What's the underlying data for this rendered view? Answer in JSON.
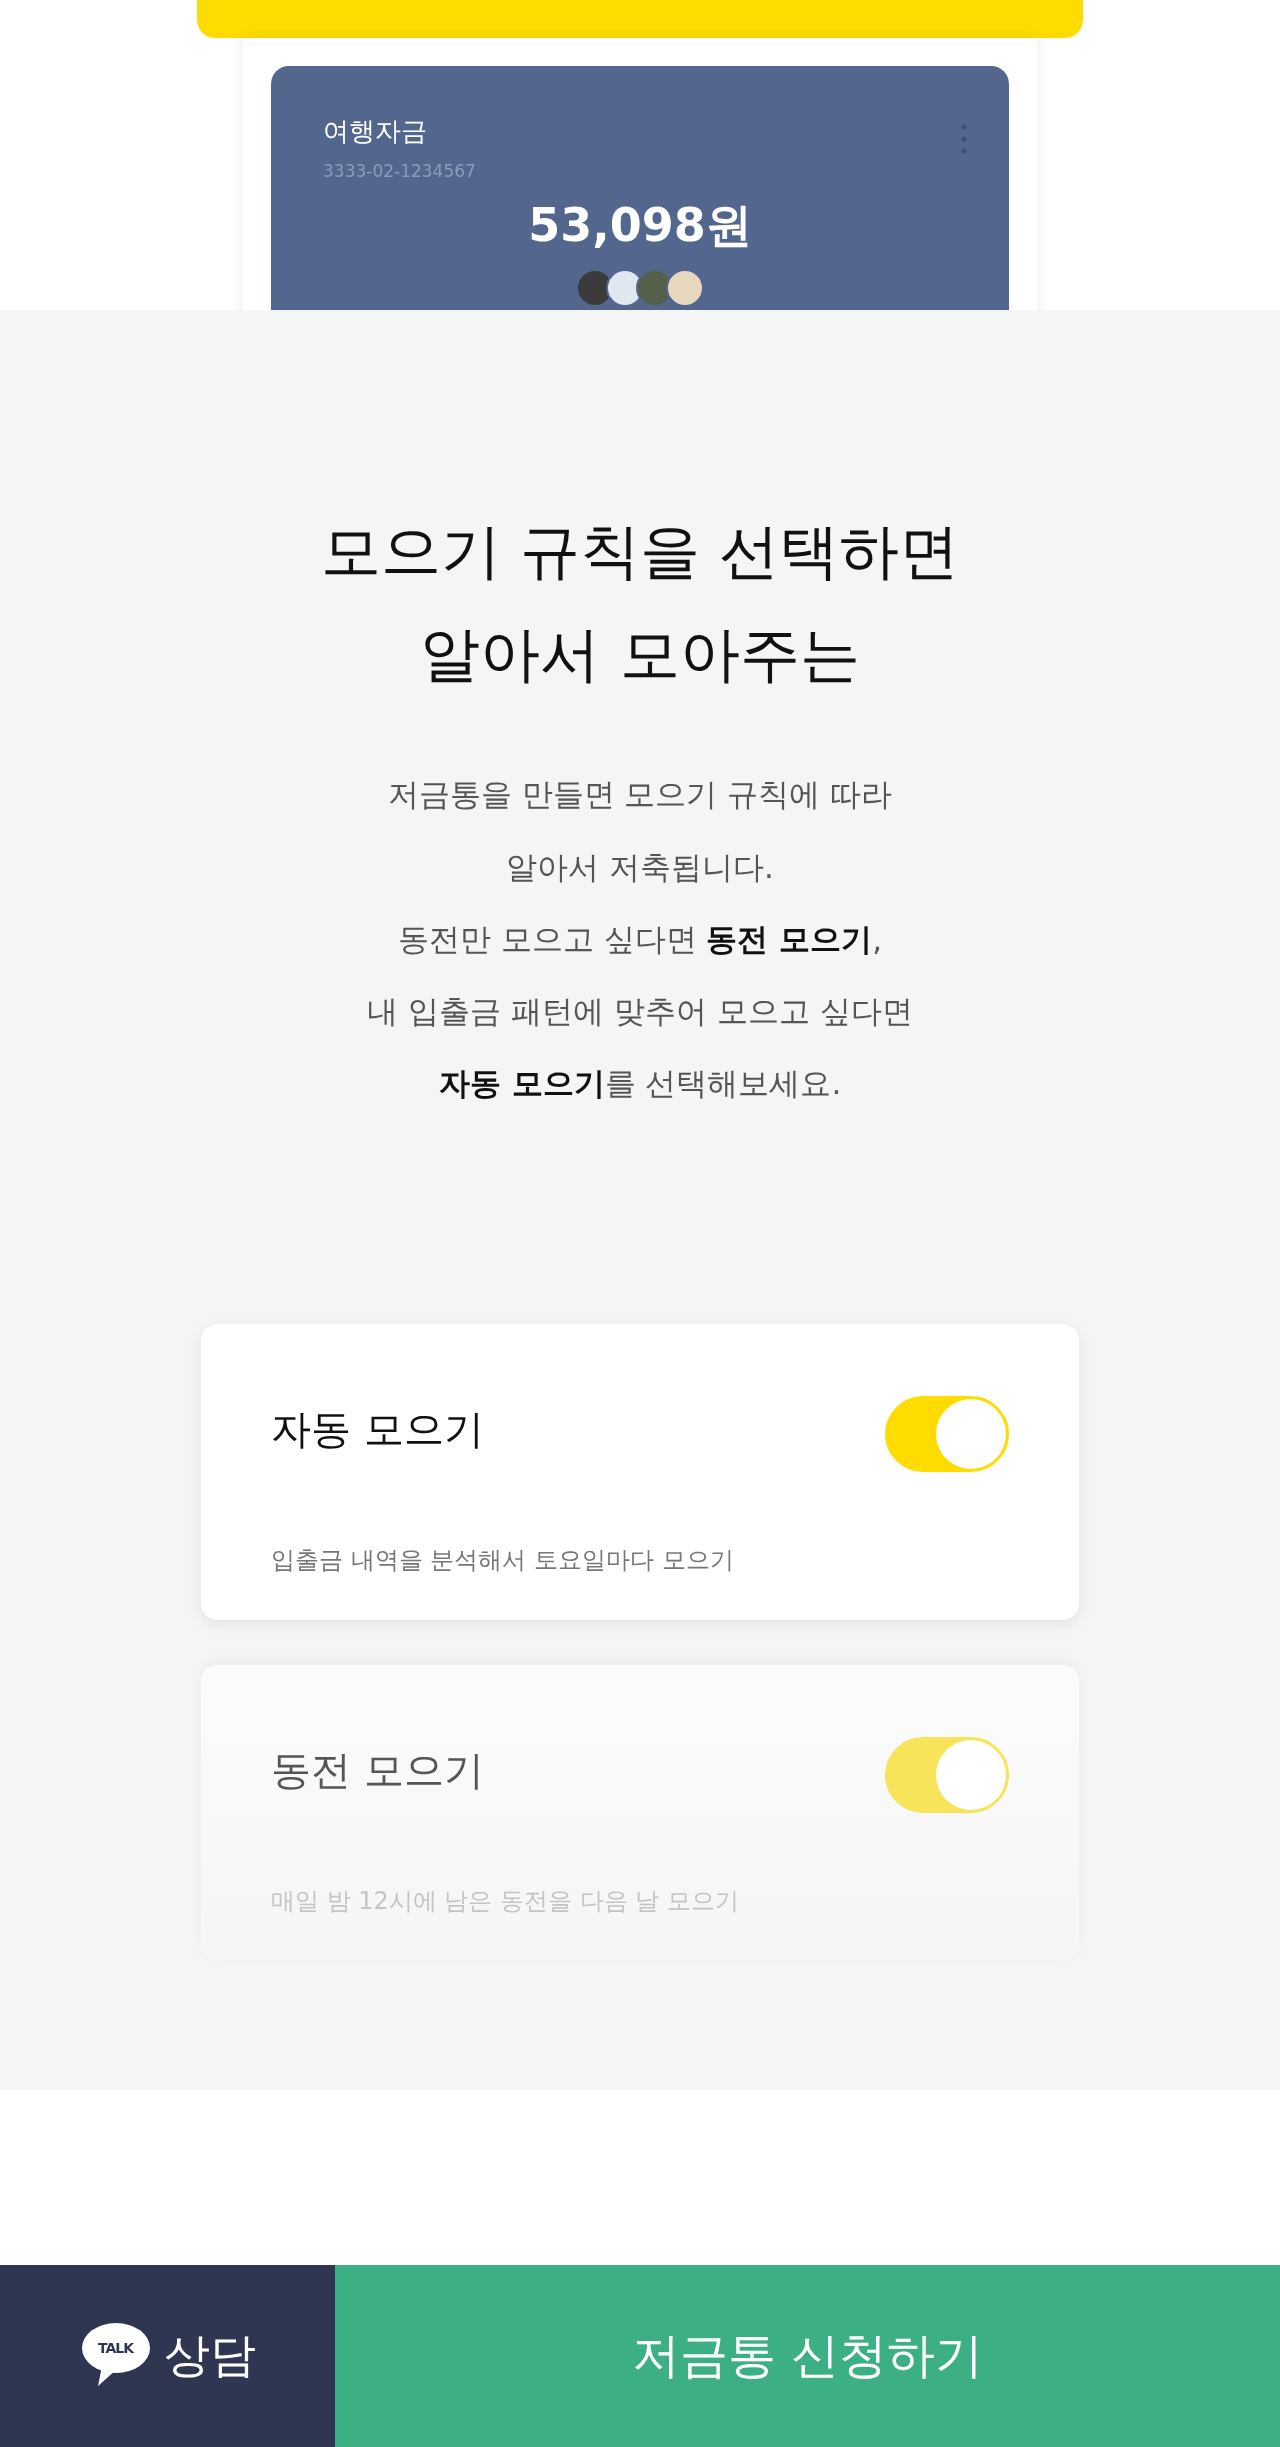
{
  "account_card": {
    "name": "여행자금",
    "number": "3333-02-1234567",
    "balance": "53,098원"
  },
  "intro": {
    "heading": "모으기 규칙을 선택하면\n알아서 모아주는",
    "body": "저금통을 만들면 모으기 규칙에 따라\n알아서 저축됩니다.\n동전만 모으고 싶다면 **동전 모으기**,\n내 입출금 패턴에 맞추어 모으고 싶다면\n**자동 모으기**를 선택해보세요."
  },
  "rules": [
    {
      "title": "자동 모으기",
      "description": "입출금 내역을 분석해서 토요일마다 모으기",
      "on": true,
      "dimmed": false
    },
    {
      "title": "동전 모으기",
      "description": "매일 밤 12시에 남은 동전을 다음 날 모으기",
      "on": true,
      "dimmed": true
    }
  ],
  "bottom_bar": {
    "chat_icon_text": "TALK",
    "chat_label": "상담",
    "apply_label": "저금통 신청하기"
  }
}
